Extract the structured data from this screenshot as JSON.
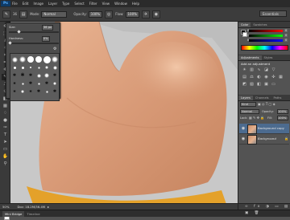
{
  "app": {
    "logo": "Ps"
  },
  "menu": {
    "items": [
      "File",
      "Edit",
      "Image",
      "Layer",
      "Type",
      "Select",
      "Filter",
      "View",
      "Window",
      "Help"
    ]
  },
  "options": {
    "size": "36",
    "mode_label": "Mode:",
    "mode_value": "Normal",
    "opacity_label": "Opacity:",
    "opacity_value": "100%",
    "flow_label": "Flow:",
    "flow_value": "100%",
    "workspace": "Essentials"
  },
  "brush_panel": {
    "size_label": "Size:",
    "size_value": "36 px",
    "hardness_label": "Hardness:",
    "hardness_value": "0%",
    "size_fraction": 0.18,
    "hardness_fraction": 0.0
  },
  "color_panel": {
    "tabs": [
      "Color",
      "Swatches"
    ],
    "r_label": "R",
    "r_value": "0",
    "g_label": "G",
    "g_value": "0",
    "b_label": "B",
    "b_value": "0"
  },
  "adjustments_panel": {
    "tabs": [
      "Adjustments",
      "Styles"
    ],
    "add_label": "Add an adjustment"
  },
  "layers_panel": {
    "tabs": [
      "Layers",
      "Channels",
      "Paths"
    ],
    "kind": "Kind",
    "blend": "Normal",
    "opacity_label": "Opacity:",
    "opacity_value": "100%",
    "lock_label": "Lock:",
    "fill_label": "Fill:",
    "fill_value": "100%",
    "layers": [
      {
        "name": "Background copy",
        "selected": true
      },
      {
        "name": "Background",
        "selected": false
      }
    ]
  },
  "status": {
    "zoom": "50%",
    "doc": "Doc: 18.2M/36.4M"
  },
  "bottom_tabs": [
    "Mini Bridge",
    "Timeline"
  ],
  "colors": {
    "skin": "#d99c78",
    "shirt": "#e8a82c",
    "background": "#c9c9c9",
    "accent_selected": "#4c6b8f"
  }
}
